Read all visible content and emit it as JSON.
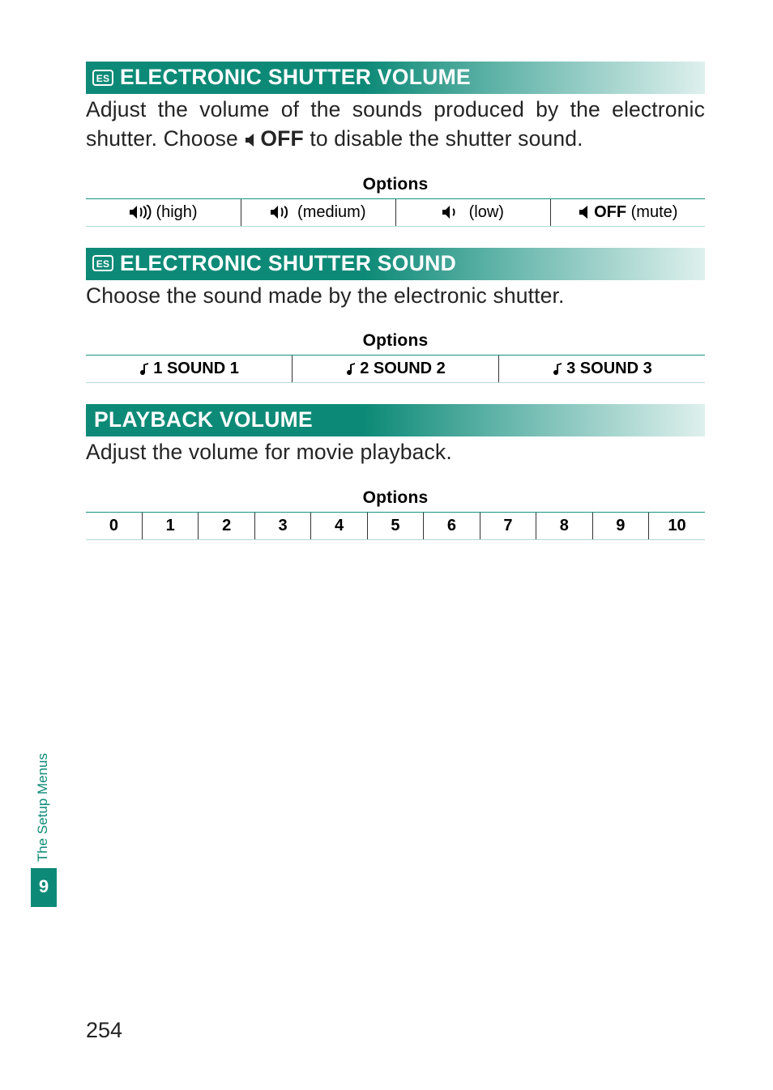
{
  "sections": {
    "shutter_volume": {
      "icon": "ES",
      "title": "ELECTRONIC SHUTTER VOLUME",
      "body_parts": [
        "Adjust the volume of the sounds produced by the electronic shutter.  Choose ",
        "OFF",
        " to disable the shutter sound."
      ],
      "options_header": "Options",
      "options": [
        {
          "icon": "speaker-high",
          "label": " (high)"
        },
        {
          "icon": "speaker-med",
          "label": " (medium)"
        },
        {
          "icon": "speaker-low",
          "label": " (low)"
        },
        {
          "icon": "speaker-mute",
          "bold": "OFF",
          "label": " (mute)"
        }
      ]
    },
    "shutter_sound": {
      "icon": "ES",
      "title": "ELECTRONIC SHUTTER SOUND",
      "body": "Choose the sound made by the electronic shutter.",
      "options_header": "Options",
      "options": [
        {
          "icon": "note",
          "pre": "1 ",
          "bold": "SOUND 1"
        },
        {
          "icon": "note",
          "pre": "2 ",
          "bold": "SOUND 2"
        },
        {
          "icon": "note",
          "pre": "3 ",
          "bold": "SOUND 3"
        }
      ]
    },
    "playback_volume": {
      "title": "PLAYBACK VOLUME",
      "body": "Adjust the volume for movie playback.",
      "options_header": "Options",
      "options": [
        "0",
        "1",
        "2",
        "3",
        "4",
        "5",
        "6",
        "7",
        "8",
        "9",
        "10"
      ]
    }
  },
  "side_tab": {
    "label": "The Setup Menus",
    "number": "9"
  },
  "page_number": "254"
}
